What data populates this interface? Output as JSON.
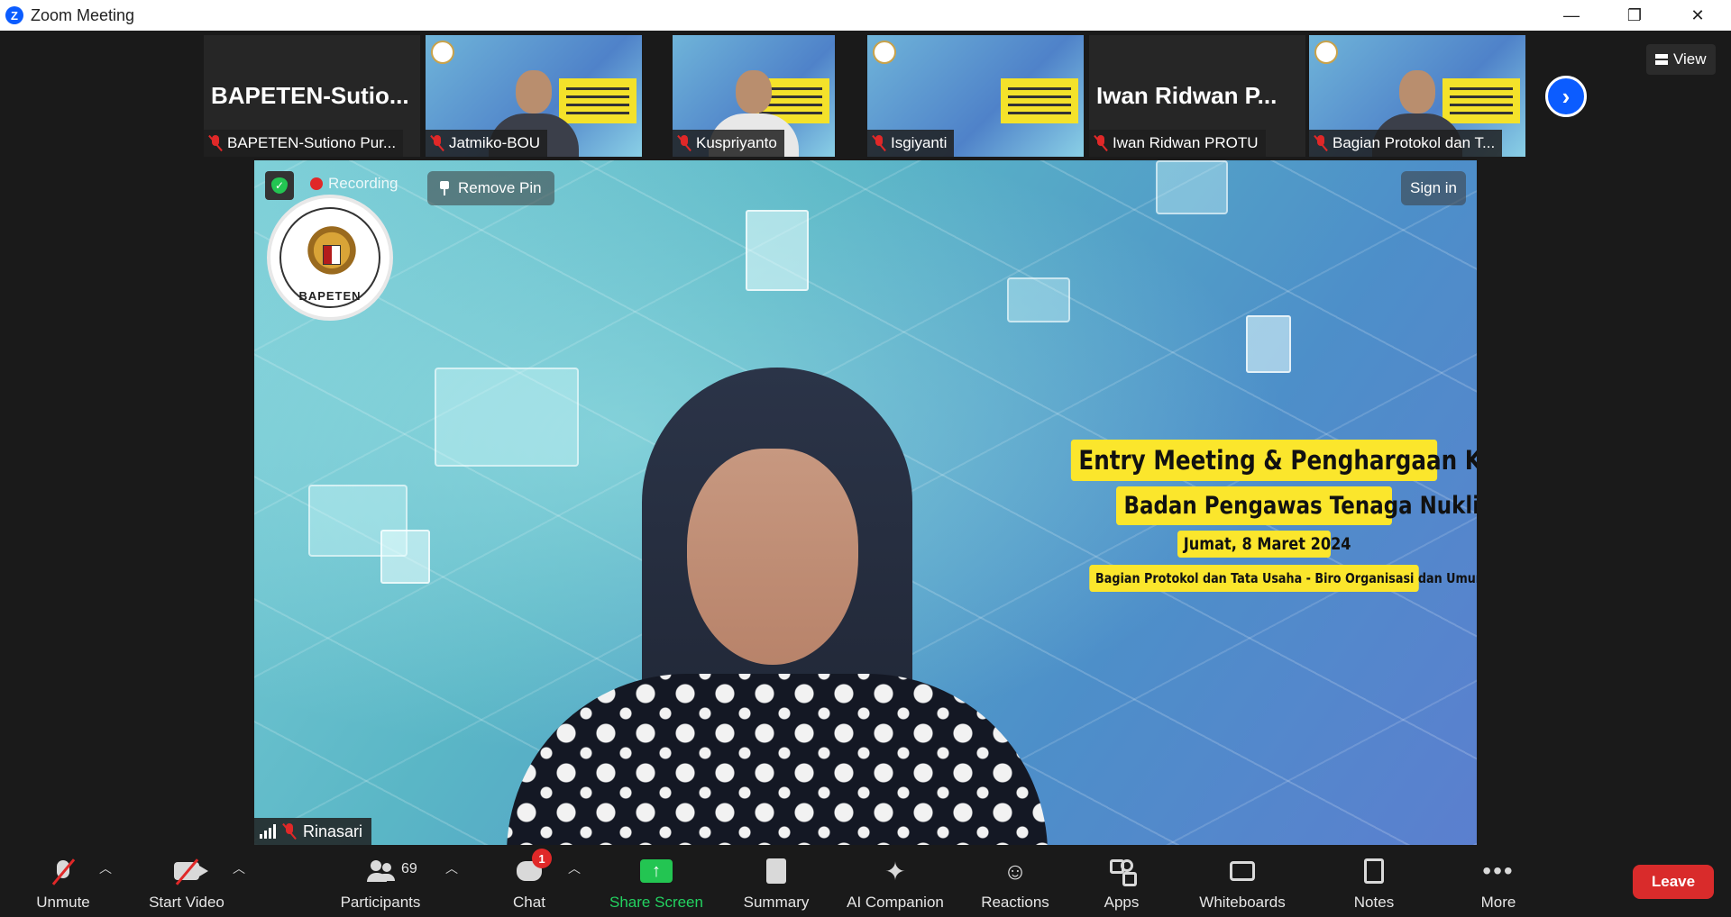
{
  "window": {
    "title": "Zoom Meeting",
    "logo_letter": "Z",
    "controls": {
      "minimize": "—",
      "restore": "❐",
      "close": "✕"
    }
  },
  "view_button": {
    "label": "View"
  },
  "thumbnails": [
    {
      "display": "BAPETEN-Sutio...",
      "name": "BAPETEN-Sutiono Pur...",
      "video": false
    },
    {
      "name": "Jatmiko-BOU",
      "video": true
    },
    {
      "name": "Kuspriyanto",
      "video": true
    },
    {
      "name": "Isgiyanti",
      "video": true
    },
    {
      "display": "Iwan Ridwan P...",
      "name": "Iwan Ridwan PROTU",
      "video": false
    },
    {
      "name": "Bagian Protokol dan T...",
      "video": true
    }
  ],
  "main_video": {
    "recording_label": "Recording",
    "remove_pin_label": "Remove Pin",
    "sign_in_label": "Sign in",
    "seal_text": "BAPETEN",
    "banner": {
      "line1": "Entry Meeting & Penghargaan Kearsipan",
      "line2": "Badan Pengawas Tenaga Nuklir",
      "line3": "Jumat, 8 Maret 2024",
      "line4": "Bagian Protokol dan Tata Usaha - Biro Organisasi dan Umum"
    },
    "speaker_name": "Rinasari"
  },
  "toolbar": {
    "unmute": "Unmute",
    "start_video": "Start Video",
    "participants": "Participants",
    "participants_count": "69",
    "chat": "Chat",
    "chat_badge": "1",
    "share_screen": "Share Screen",
    "summary": "Summary",
    "ai_companion": "AI Companion",
    "reactions": "Reactions",
    "apps": "Apps",
    "whiteboards": "Whiteboards",
    "notes": "Notes",
    "more": "More",
    "leave": "Leave"
  },
  "colors": {
    "accent": "#0b5cff",
    "share_green": "#23c552",
    "leave_red": "#d92b2b",
    "muted_red": "#e02828",
    "banner_yellow": "#fbe62c"
  }
}
